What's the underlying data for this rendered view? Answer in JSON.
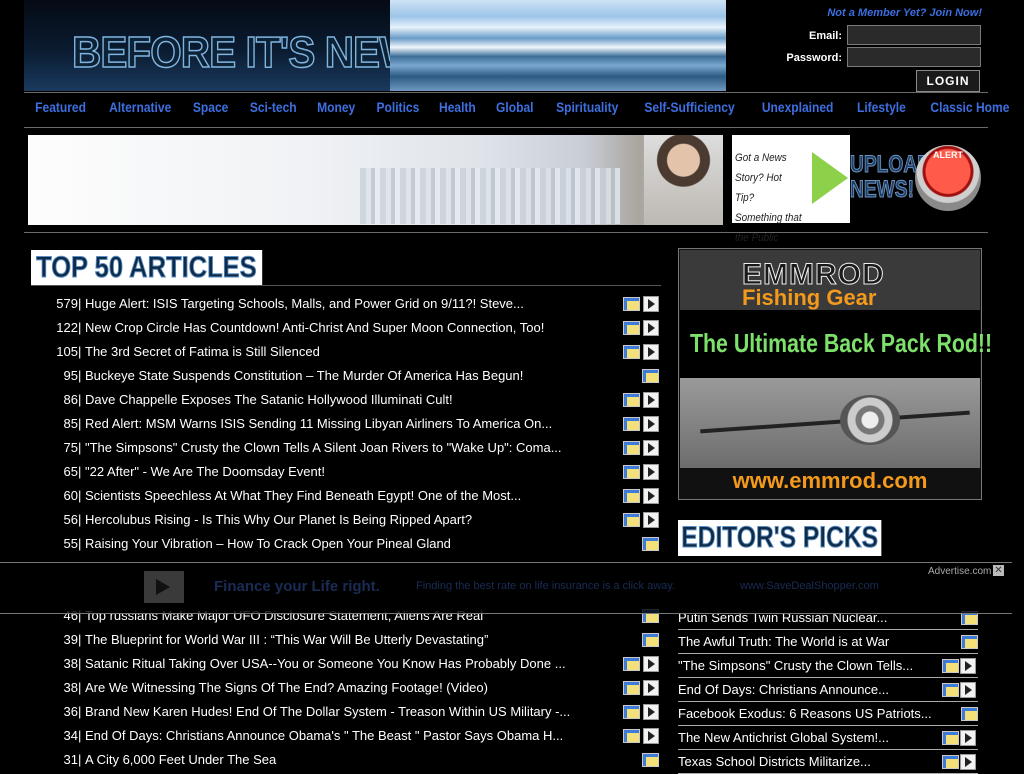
{
  "header": {
    "logo_text": "BEFORE IT'S NEWS",
    "member_link": "Not a Member Yet? Join Now!",
    "email_label": "Email:",
    "password_label": "Password:",
    "login_button": "LOGIN"
  },
  "nav": [
    "Featured",
    "Alternative",
    "Space",
    "Sci-tech",
    "Money",
    "Politics",
    "Health",
    "Global",
    "Spirituality",
    "Self-Sufficiency",
    "Unexplained",
    "Lifestyle",
    "Classic Home"
  ],
  "banner": {
    "tip_text": "Got a News Story? Hot Tip? Something that the Public Needs to Know?",
    "upload_text": "UPLOAD NEWS!",
    "alert_label": "ALERT"
  },
  "top50": {
    "title": "TOP 50 ARTICLES",
    "articles": [
      {
        "count": "579",
        "title": "Huge Alert: ISIS Targeting Schools, Malls, and Power Grid on 9/11?! Steve...",
        "video": true
      },
      {
        "count": "122",
        "title": "New Crop Circle Has Countdown! Anti-Christ And Super Moon Connection, Too!",
        "video": true
      },
      {
        "count": "105",
        "title": "The 3rd Secret of Fatima is Still Silenced",
        "video": true
      },
      {
        "count": "95",
        "title": "Buckeye State Suspends Constitution – The Murder Of America Has Begun!",
        "video": false
      },
      {
        "count": "86",
        "title": "Dave Chappelle Exposes The Satanic Hollywood Illuminati Cult!",
        "video": true
      },
      {
        "count": "85",
        "title": "Red Alert: MSM Warns ISIS Sending 11 Missing Libyan Airliners To America On...",
        "video": true
      },
      {
        "count": "75",
        "title": "\"The Simpsons\" Crusty the Clown Tells A Silent Joan Rivers to \"Wake Up\": Coma...",
        "video": true
      },
      {
        "count": "65",
        "title": "\"22 After\" - We Are The Doomsday Event!",
        "video": true
      },
      {
        "count": "60",
        "title": "Scientists Speechless At What They Find Beneath Egypt! One of the Most...",
        "video": true
      },
      {
        "count": "56",
        "title": "Hercolubus Rising - Is This Why Our Planet Is Being Ripped Apart?",
        "video": true
      },
      {
        "count": "55",
        "title": "Raising Your Vibration – How To Crack Open Your Pineal Gland",
        "video": false
      },
      {
        "count": "46",
        "title": "Top russians Make Major UFO Disclosure Statement, Aliens Are Real",
        "video": false
      },
      {
        "count": "39",
        "title": "The Blueprint for World War III : “This War Will Be Utterly Devastating”",
        "video": false
      },
      {
        "count": "38",
        "title": "Satanic Ritual Taking Over USA--You or Someone You Know Has Probably Done ...",
        "video": true
      },
      {
        "count": "38",
        "title": "Are We Witnessing The Signs Of The End? Amazing Footage! (Video)",
        "video": true
      },
      {
        "count": "36",
        "title": "Brand New Karen Hudes! End Of The Dollar System - Treason Within US Military -...",
        "video": true
      },
      {
        "count": "34",
        "title": "End Of Days: Christians Announce Obama's \" The Beast \" Pastor Says Obama H...",
        "video": true
      },
      {
        "count": "31",
        "title": "A City 6,000 Feet Under The Sea",
        "video": false
      }
    ]
  },
  "emmrod": {
    "brand": "EMMROD",
    "sub": "Fishing Gear",
    "tagline": "The Ultimate Back Pack Rod!!",
    "url": "www.emmrod.com"
  },
  "editors_picks": {
    "title": "EDITOR'S PICKS",
    "items": [
      {
        "title": "Putin Sends Twin Russian Nuclear...",
        "video": false
      },
      {
        "title": "The Awful Truth: The World is at War",
        "video": false
      },
      {
        "title": "\"The Simpsons\" Crusty the Clown Tells...",
        "video": true
      },
      {
        "title": "End Of Days: Christians Announce...",
        "video": true
      },
      {
        "title": "Facebook Exodus: 6 Reasons US Patriots...",
        "video": false
      },
      {
        "title": "The New Antichrist Global System!...",
        "video": true
      },
      {
        "title": "Texas School Districts Militarize...",
        "video": true
      }
    ]
  },
  "adbar": {
    "headline": "Finance your Life right.",
    "text": "Finding the best rate on life insurance is a click away.",
    "url": "www.SaveDealShopper.com",
    "advertise": "Advertise.com",
    "close": "✕"
  }
}
